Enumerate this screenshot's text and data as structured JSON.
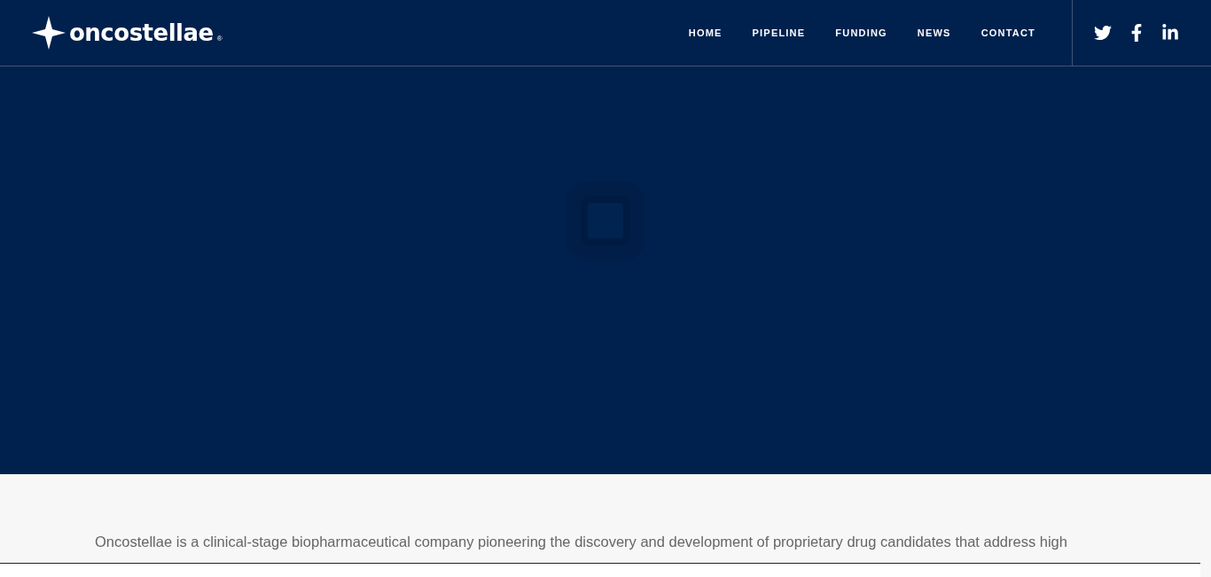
{
  "header": {
    "logo": {
      "name": "oncostellae",
      "mark": "®"
    },
    "nav": [
      {
        "label": "HOME"
      },
      {
        "label": "PIPELINE"
      },
      {
        "label": "FUNDING"
      },
      {
        "label": "NEWS"
      },
      {
        "label": "CONTACT"
      }
    ],
    "social": [
      {
        "kind": "twitter"
      },
      {
        "kind": "facebook"
      },
      {
        "kind": "linkedin"
      }
    ]
  },
  "hero": {
    "loading": true
  },
  "intro": {
    "text": "Oncostellae is a clinical-stage biopharmaceutical company pioneering the discovery and development of proprietary drug candidates that address high"
  }
}
